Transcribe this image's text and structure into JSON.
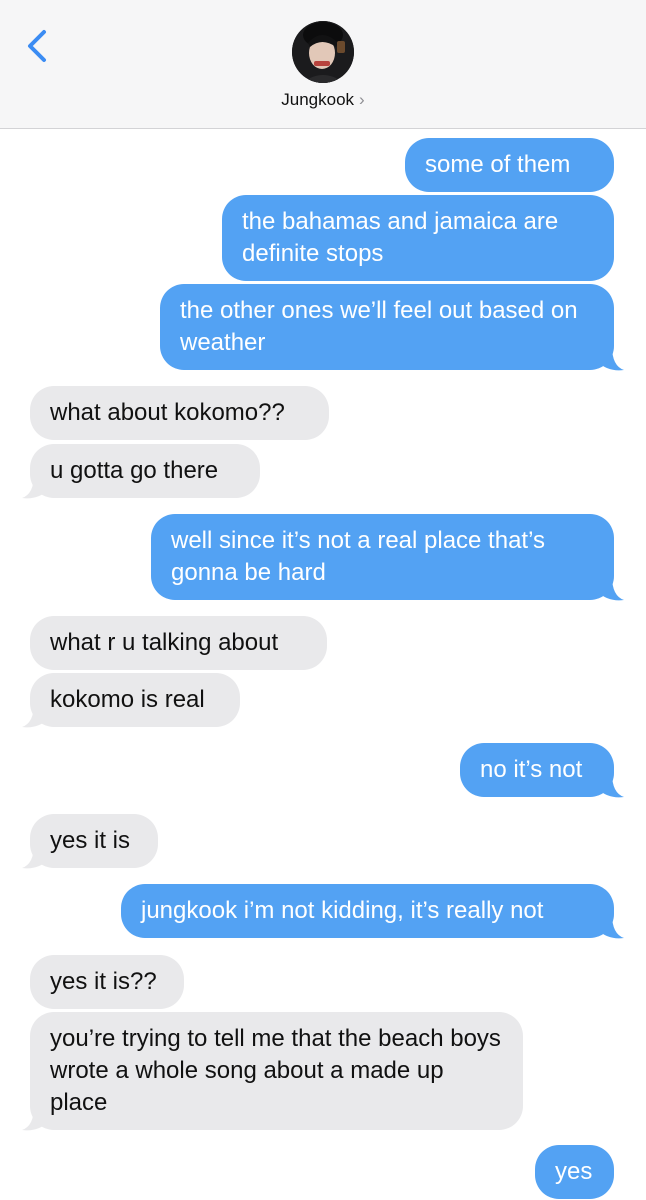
{
  "header": {
    "contact_name": "Jungkook",
    "chevron": "›",
    "back_icon": "chevron-left-icon"
  },
  "colors": {
    "sent_bubble": "#53a2f3",
    "received_bubble": "#e9e9eb",
    "accent": "#3b8cf3"
  },
  "messages": [
    {
      "side": "sent",
      "text": "some of them"
    },
    {
      "side": "sent",
      "text": "the bahamas and jamaica are definite stops"
    },
    {
      "side": "sent",
      "text": "the other ones we’ll feel out based on weather"
    },
    {
      "side": "received",
      "text": "what about kokomo??"
    },
    {
      "side": "received",
      "text": "u gotta go there"
    },
    {
      "side": "sent",
      "text": "well since it’s not a real place that’s gonna be hard"
    },
    {
      "side": "received",
      "text": "what r u talking about"
    },
    {
      "side": "received",
      "text": "kokomo is real"
    },
    {
      "side": "sent",
      "text": "no it’s not"
    },
    {
      "side": "received",
      "text": "yes it is"
    },
    {
      "side": "sent",
      "text": "jungkook i’m not kidding, it’s really not"
    },
    {
      "side": "received",
      "text": "yes it is??"
    },
    {
      "side": "received",
      "text": "you’re trying to tell me that the beach boys wrote a whole song about a made up place"
    },
    {
      "side": "sent",
      "text": "yes"
    }
  ]
}
